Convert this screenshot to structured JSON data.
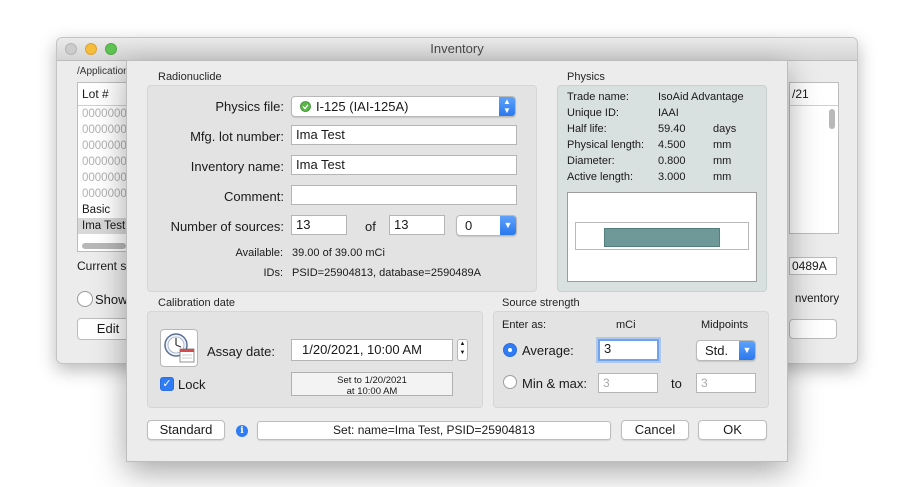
{
  "background_window": {
    "title": "Inventory",
    "path": "/Application",
    "list_header": "Lot #",
    "list_rows": [
      "0000000",
      "0000000",
      "0000000",
      "0000000",
      "0000000",
      "0000000",
      "Basic",
      "Ima Test"
    ],
    "current_label": "Current se",
    "show_label": "Show",
    "edit_label": "Edit",
    "right_header": "/21",
    "right_value": "0489A",
    "right_inventory": "nventory"
  },
  "radionuclide": {
    "section_label": "Radionuclide",
    "physics_file_label": "Physics file:",
    "physics_file_value": "I-125 (IAI-125A)",
    "mfg_lot_label": "Mfg. lot number:",
    "mfg_lot_value": "Ima Test",
    "inventory_name_label": "Inventory name:",
    "inventory_name_value": "Ima Test",
    "comment_label": "Comment:",
    "comment_value": "",
    "num_sources_label": "Number of sources:",
    "num_sources_value": "13",
    "of_label": "of",
    "total_sources_value": "13",
    "extra_select_value": "0",
    "available_label": "Available:",
    "available_value": "39.00 of 39.00 mCi",
    "ids_label": "IDs:",
    "ids_value": "PSID=25904813, database=2590489A"
  },
  "physics": {
    "section_label": "Physics",
    "rows": [
      {
        "key": "Trade name:",
        "value": "IsoAid Advantage",
        "unit": ""
      },
      {
        "key": "Unique ID:",
        "value": "IAAI",
        "unit": ""
      },
      {
        "key": "Half life:",
        "value": "59.40",
        "unit": "days"
      },
      {
        "key": "Physical length:",
        "value": "4.500",
        "unit": "mm"
      },
      {
        "key": "Diameter:",
        "value": "0.800",
        "unit": "mm"
      },
      {
        "key": "Active length:",
        "value": "3.000",
        "unit": "mm"
      }
    ]
  },
  "calibration": {
    "section_label": "Calibration date",
    "assay_label": "Assay date:",
    "assay_value": "1/20/2021, 10:00 AM",
    "lock_label": "Lock",
    "set_to_line1": "Set to 1/20/2021",
    "set_to_line2": "at 10:00 AM"
  },
  "source_strength": {
    "section_label": "Source strength",
    "enter_as_label": "Enter as:",
    "mci_header": "mCi",
    "midpoints_header": "Midpoints",
    "average_label": "Average:",
    "average_value": "3",
    "midpoints_value": "Std.",
    "minmax_label": "Min & max:",
    "min_value": "3",
    "to_label": "to",
    "max_value": "3"
  },
  "footer": {
    "standard_label": "Standard",
    "info_icon_glyph": "i",
    "status_text": "Set: name=Ima Test, PSID=25904813",
    "cancel_label": "Cancel",
    "ok_label": "OK"
  },
  "colors": {
    "accent": "#2f7cf6",
    "physics_panel": "#d9e0e0",
    "preview_core": "#6f9999"
  }
}
